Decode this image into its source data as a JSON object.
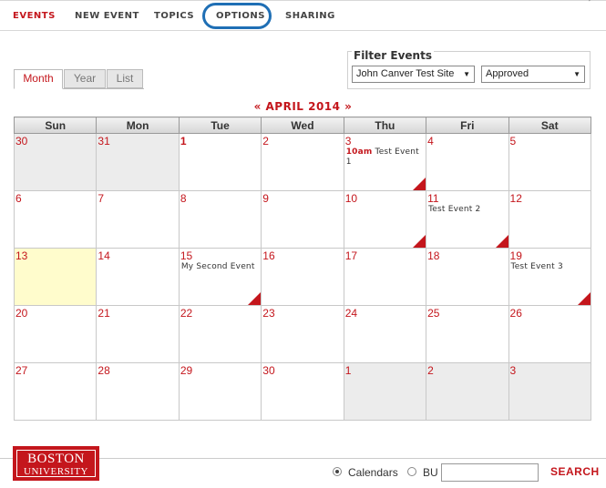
{
  "nav": {
    "tabs": [
      {
        "label": "EVENTS"
      },
      {
        "label": "NEW EVENT"
      },
      {
        "label": "TOPICS"
      },
      {
        "label": "OPTIONS"
      },
      {
        "label": "SHARING"
      }
    ]
  },
  "view_tabs": [
    {
      "label": "Month"
    },
    {
      "label": "Year"
    },
    {
      "label": "List"
    }
  ],
  "filter": {
    "title": "Filter Events",
    "site": "John Canver Test Site",
    "status": "Approved"
  },
  "calendar": {
    "title": "« APRIL 2014 »",
    "weekdays": [
      "Sun",
      "Mon",
      "Tue",
      "Wed",
      "Thu",
      "Fri",
      "Sat"
    ],
    "weeks": [
      [
        {
          "day": "30"
        },
        {
          "day": "31"
        },
        {
          "day": "1"
        },
        {
          "day": "2"
        },
        {
          "day": "3",
          "event_time": "10am",
          "event": " Test Event 1"
        },
        {
          "day": "4"
        },
        {
          "day": "5"
        }
      ],
      [
        {
          "day": "6"
        },
        {
          "day": "7"
        },
        {
          "day": "8"
        },
        {
          "day": "9"
        },
        {
          "day": "10"
        },
        {
          "day": "11",
          "event": "Test Event 2"
        },
        {
          "day": "12"
        }
      ],
      [
        {
          "day": "13"
        },
        {
          "day": "14"
        },
        {
          "day": "15",
          "event": "My Second Event"
        },
        {
          "day": "16"
        },
        {
          "day": "17"
        },
        {
          "day": "18"
        },
        {
          "day": "19",
          "event": "Test Event 3"
        }
      ],
      [
        {
          "day": "20"
        },
        {
          "day": "21"
        },
        {
          "day": "22"
        },
        {
          "day": "23"
        },
        {
          "day": "24"
        },
        {
          "day": "25"
        },
        {
          "day": "26"
        }
      ],
      [
        {
          "day": "27"
        },
        {
          "day": "28"
        },
        {
          "day": "29"
        },
        {
          "day": "30"
        },
        {
          "day": "1"
        },
        {
          "day": "2"
        },
        {
          "day": "3"
        }
      ]
    ]
  },
  "footer": {
    "logo_line1": "BOSTON",
    "logo_line2": "UNIVERSITY",
    "radio_calendars": "Calendars",
    "radio_bu": "BU",
    "search_value": "",
    "search_button": "SEARCH"
  }
}
